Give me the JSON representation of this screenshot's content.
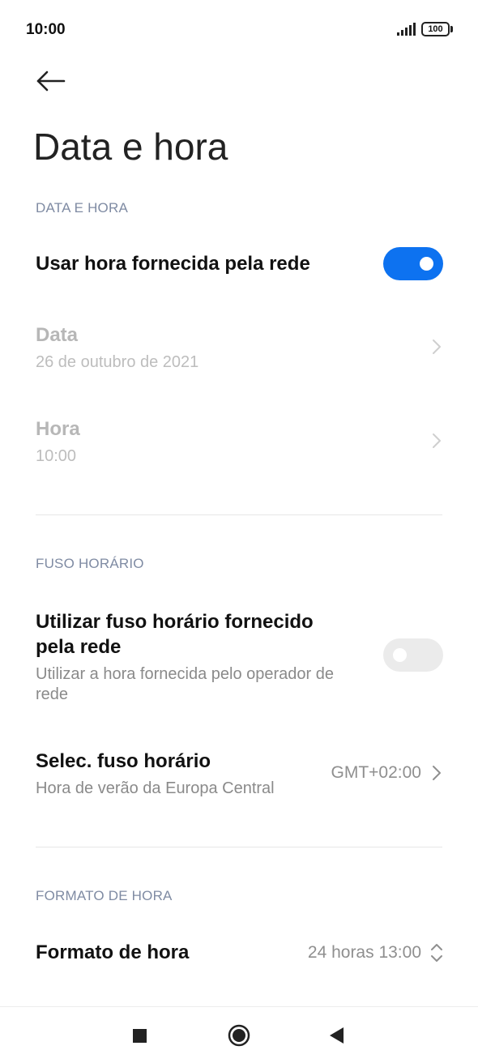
{
  "status_bar": {
    "time": "10:00",
    "battery_level": "100",
    "signal_icon": "signal-bars-icon",
    "battery_icon": "battery-icon"
  },
  "header": {
    "back_icon": "arrow-left-icon",
    "title": "Data e hora"
  },
  "sections": {
    "date_time": {
      "header": "DATA E HORA",
      "network_time": {
        "label": "Usar hora fornecida pela rede",
        "enabled": true
      },
      "date": {
        "label": "Data",
        "value": "26 de outubro de 2021"
      },
      "time": {
        "label": "Hora",
        "value": "10:00"
      }
    },
    "timezone": {
      "header": "FUSO HORÁRIO",
      "network_timezone": {
        "label_line1": "Utilizar fuso horário fornecido",
        "label_line2": "pela rede",
        "sub_line1": "Utilizar a hora fornecida pelo operador de",
        "sub_line2": "rede",
        "enabled": false
      },
      "select_timezone": {
        "label": "Selec. fuso horário",
        "sub": "Hora de verão da Europa Central",
        "value": "GMT+02:00"
      }
    },
    "time_format": {
      "header": "FORMATO DE HORA",
      "format": {
        "label": "Formato de hora",
        "value": "24 horas 13:00"
      }
    }
  },
  "nav_bar": {
    "recents_icon": "square-icon",
    "home_icon": "circle-icon",
    "back_icon": "triangle-back-icon"
  },
  "colors": {
    "accent": "#0d72f0",
    "section_header": "#7f8ba3",
    "disabled_text": "#b7b7b7"
  }
}
